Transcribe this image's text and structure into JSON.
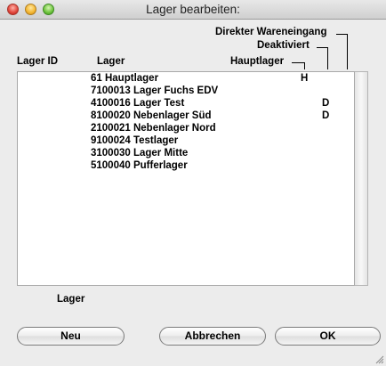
{
  "window": {
    "title": "Lager bearbeiten:"
  },
  "headers": {
    "lager_id": "Lager ID",
    "lager": "Lager",
    "hauptlager": "Hauptlager",
    "deaktiviert": "Deaktiviert",
    "direkter_wareneingang": "Direkter Wareneingang"
  },
  "rows": [
    {
      "lager": "61 Hauptlager",
      "hauptlager": "H",
      "deaktiviert": ""
    },
    {
      "lager": "7100013 Lager Fuchs EDV",
      "hauptlager": "",
      "deaktiviert": ""
    },
    {
      "lager": "4100016 Lager Test",
      "hauptlager": "",
      "deaktiviert": "D"
    },
    {
      "lager": "8100020 Nebenlager Süd",
      "hauptlager": "",
      "deaktiviert": "D"
    },
    {
      "lager": "2100021 Nebenlager Nord",
      "hauptlager": "",
      "deaktiviert": ""
    },
    {
      "lager": "9100024 Testlager",
      "hauptlager": "",
      "deaktiviert": ""
    },
    {
      "lager": "3100030 Lager Mitte",
      "hauptlager": "",
      "deaktiviert": ""
    },
    {
      "lager": "5100040 Pufferlager",
      "hauptlager": "",
      "deaktiviert": ""
    }
  ],
  "footer": {
    "label": "Lager"
  },
  "buttons": {
    "new": "Neu",
    "cancel": "Abbrechen",
    "ok": "OK"
  },
  "icons": {
    "close": "close-button-icon",
    "minimize": "minimize-button-icon",
    "zoom": "zoom-button-icon",
    "resize": "resize-grip-icon"
  },
  "colors": {
    "background": "#ececec",
    "list_background": "#ffffff"
  }
}
